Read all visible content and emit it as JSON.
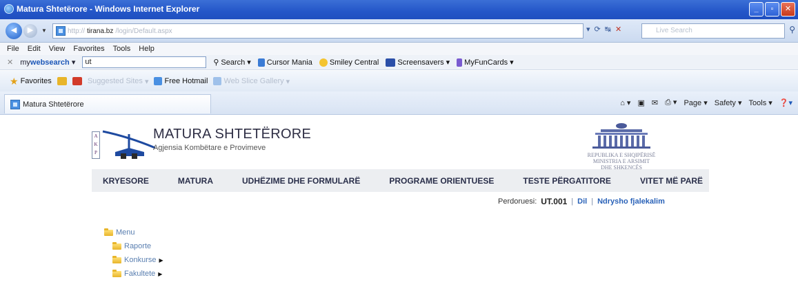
{
  "window": {
    "title": "Matura Shtetërore - Windows Internet Explorer",
    "buttons": [
      "_",
      "▫",
      "✕"
    ]
  },
  "address": {
    "url_prefix": "http://",
    "url_host": "tirana.bz",
    "url_rest": "/login/Default.aspx",
    "search_placeholder": "Live Search"
  },
  "menu": {
    "items": [
      "File",
      "Edit",
      "View",
      "Favorites",
      "Tools",
      "Help"
    ]
  },
  "toolbar": {
    "close": "✕",
    "brand_prefix": "my",
    "brand_main": "websearch",
    "search_value": "ut",
    "items": [
      "Search",
      "Cursor Mania",
      "Smiley Central",
      "Screensavers",
      "MyFunCards"
    ]
  },
  "favorites": {
    "label": "Favorites",
    "items": [
      "Suggested Sites",
      "Free Hotmail",
      "Web Slice Gallery"
    ]
  },
  "tab": {
    "title": "Matura Shtetërore"
  },
  "commandbar": {
    "items": [
      "Page",
      "Safety",
      "Tools"
    ]
  },
  "site": {
    "logo_letters": "A\nK\nP",
    "title": "MATURA SHTETËRORE",
    "subtitle": "Agjensia Kombëtare e Provimeve",
    "ministry": "REPUBLIKA E SHQIPËRISË\nMINISTRIA E ARSIMIT\nDHE SHKENCËS"
  },
  "nav": {
    "items": [
      "KRYESORE",
      "MATURA",
      "UDHËZIME DHE FORMULARË",
      "PROGRAME ORIENTUESE",
      "TESTE PËRGATITORE",
      "VITET MË PARË"
    ]
  },
  "user": {
    "label": "Perdoruesi:",
    "id": "UT.001",
    "logout": "Dil",
    "change_password": "Ndrysho fjalekalim"
  },
  "tree": {
    "root": "Menu",
    "children": [
      "Raporte",
      "Konkurse",
      "Fakultete"
    ]
  }
}
